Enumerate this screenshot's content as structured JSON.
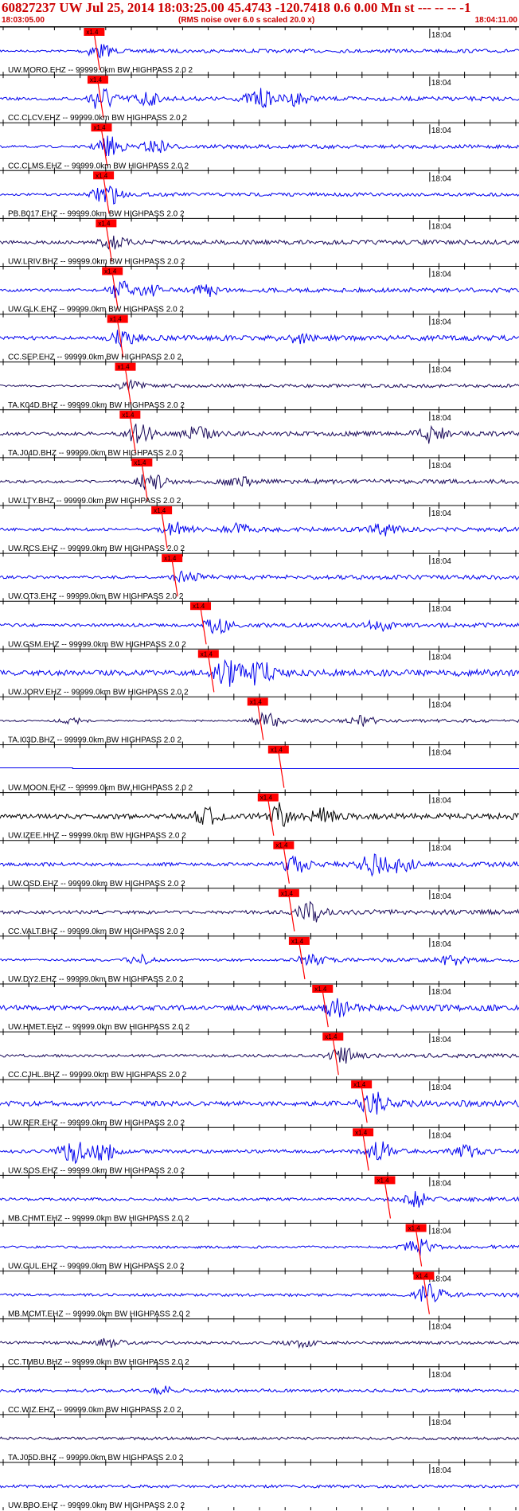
{
  "header": {
    "title": "60827237 UW Jul 25, 2014 18:03:25.00   45.4743 -120.7418  0.6 0.00 Mn st --- -- --  -1",
    "start_time": "18:03:05.00",
    "noise_note": "(RMS noise over 6.0 s scaled 20.0 x)",
    "end_time": "18:04:11.00"
  },
  "colors": {
    "trace_blue": "#0000ee",
    "trace_dark": "#1a0a5a",
    "trace_black": "#000000",
    "pick_red": "#ff0000",
    "title_red": "#cc0000"
  },
  "chart_data": {
    "type": "line",
    "title": "60827237 UW Jul 25, 2014 18:03:25.00",
    "x_start": "18:03:05.00",
    "x_end": "18:04:11.00",
    "time_mark": "18:04",
    "pick_label": "x1.4",
    "filter": "HIGHPASS  2.0  2",
    "stations": [
      {
        "label": "UW.MORO.EHZ -- 99999.0km BW  HIGHPASS  2.0  2",
        "color": "#0000ee",
        "pick": 18.0,
        "amp": 0.22,
        "bursts": [
          [
            19,
            1.5
          ]
        ]
      },
      {
        "label": "CC.CLCV.EHZ -- 99999.0km BW  HIGHPASS  2.0  2",
        "color": "#0000ee",
        "pick": 18.7,
        "amp": 0.3,
        "bursts": [
          [
            19.5,
            2.6
          ],
          [
            28,
            1.4
          ],
          [
            50,
            1.9
          ],
          [
            57,
            1.2
          ]
        ]
      },
      {
        "label": "CC.CLMS.EHZ -- 99999.0km BW  HIGHPASS  2.0  2",
        "color": "#0000ee",
        "pick": 19.4,
        "amp": 0.25,
        "bursts": [
          [
            21,
            2.0
          ],
          [
            30,
            1.2
          ]
        ]
      },
      {
        "label": "PB.B017.EHZ -- 99999.0km BW  HIGHPASS  2.0  2",
        "color": "#0000ee",
        "pick": 19.8,
        "amp": 0.22,
        "bursts": [
          [
            20.5,
            2.4
          ]
        ]
      },
      {
        "label": "UW.LRIV.BHZ -- 99999.0km BW  HIGHPASS  2.0  2",
        "color": "#1a0a5a",
        "pick": 20.3,
        "amp": 0.32,
        "bursts": [
          [
            21.5,
            1.3
          ]
        ]
      },
      {
        "label": "UW.GLK.EHZ -- 99999.0km BW  HIGHPASS  2.0  2",
        "color": "#0000ee",
        "pick": 21.5,
        "amp": 0.3,
        "bursts": [
          [
            23.5,
            1.7
          ],
          [
            29,
            0.9
          ],
          [
            40,
            1.0
          ]
        ]
      },
      {
        "label": "CC.SEP.EHZ -- 99999.0km BW  HIGHPASS  2.0  2",
        "color": "#0000ee",
        "pick": 22.5,
        "amp": 0.38,
        "bursts": [
          [
            24,
            1.6
          ],
          [
            57,
            1.0
          ]
        ]
      },
      {
        "label": "TA.K04D.BHZ -- 99999.0km BW  HIGHPASS  2.0  2",
        "color": "#1a0a5a",
        "pick": 24.0,
        "amp": 0.2,
        "bursts": [
          [
            25,
            0.9
          ]
        ]
      },
      {
        "label": "TA.J04D.BHZ -- 99999.0km BW  HIGHPASS  2.0  2",
        "color": "#1a0a5a",
        "pick": 24.9,
        "amp": 0.35,
        "bursts": [
          [
            27,
            1.8
          ],
          [
            38,
            1.3
          ],
          [
            83,
            1.9
          ]
        ]
      },
      {
        "label": "UW.LTY.BHZ -- 99999.0km BW  HIGHPASS  2.0  2",
        "color": "#1a0a5a",
        "pick": 27.2,
        "amp": 0.3,
        "bursts": [
          [
            29,
            1.6
          ],
          [
            46,
            0.9
          ]
        ]
      },
      {
        "label": "UW.RCS.EHZ -- 99999.0km BW  HIGHPASS  2.0  2",
        "color": "#0000ee",
        "pick": 31.0,
        "amp": 0.3,
        "bursts": [
          [
            34,
            1.4
          ],
          [
            46,
            1.1
          ],
          [
            74,
            1.0
          ]
        ]
      },
      {
        "label": "UW.OT3.EHZ -- 99999.0km BW  HIGHPASS  2.0  2",
        "color": "#0000ee",
        "pick": 33.0,
        "amp": 0.3,
        "bursts": [
          [
            36,
            1.0
          ]
        ]
      },
      {
        "label": "UW.GSM.EHZ -- 99999.0km BW  HIGHPASS  2.0  2",
        "color": "#0000ee",
        "pick": 38.5,
        "amp": 0.32,
        "bursts": [
          [
            42,
            1.5
          ],
          [
            73,
            1.0
          ]
        ]
      },
      {
        "label": "UW.JORV.EHZ -- 99999.0km BW  HIGHPASS  2.0  2",
        "color": "#0000ee",
        "pick": 40.0,
        "amp": 0.55,
        "bursts": [
          [
            44,
            2.8
          ],
          [
            50,
            2.2
          ]
        ]
      },
      {
        "label": "TA.I03D.BHZ -- 99999.0km BW  HIGHPASS  2.0  2",
        "color": "#1a0a5a",
        "pick": 49.5,
        "amp": 0.18,
        "bursts": [
          [
            51.5,
            1.8
          ],
          [
            14,
            0.6
          ],
          [
            70,
            0.9
          ]
        ]
      },
      {
        "label": "UW.MOON.EHZ -- 99999.0km BW  HIGHPASS  2.0  2",
        "color": "#0000ee",
        "pick": 53.5,
        "amp": 0.0,
        "bursts": []
      },
      {
        "label": "UW.IZEE.HHZ -- 99999.0km BW  HIGHPASS  2.0  2",
        "color": "#000000",
        "pick": 51.5,
        "amp": 0.5,
        "bursts": [
          [
            53.5,
            2.6
          ],
          [
            40,
            1.6
          ],
          [
            62,
            1.3
          ]
        ]
      },
      {
        "label": "UW.OSD.EHZ -- 99999.0km BW  HIGHPASS  2.0  2",
        "color": "#0000ee",
        "pick": 54.5,
        "amp": 0.35,
        "bursts": [
          [
            57,
            1.6
          ],
          [
            72,
            2.0
          ],
          [
            77,
            1.6
          ]
        ]
      },
      {
        "label": "CC.VALT.BHZ -- 99999.0km BW  HIGHPASS  2.0  2",
        "color": "#1a0a5a",
        "pick": 55.5,
        "amp": 0.35,
        "bursts": [
          [
            60,
            1.9
          ]
        ]
      },
      {
        "label": "UW.DY2.EHZ -- 99999.0km BW  HIGHPASS  2.0  2",
        "color": "#0000ee",
        "pick": 57.5,
        "amp": 0.25,
        "bursts": [
          [
            27,
            1.0
          ],
          [
            60,
            1.0
          ],
          [
            87,
            1.0
          ]
        ]
      },
      {
        "label": "UW.HMET.EHZ -- 99999.0km BW  HIGHPASS  2.0  2",
        "color": "#0000ee",
        "pick": 62.0,
        "amp": 0.5,
        "bursts": [
          [
            65,
            1.7
          ]
        ]
      },
      {
        "label": "CC.CJHL.BHZ -- 99999.0km BW  HIGHPASS  2.0  2",
        "color": "#1a0a5a",
        "pick": 64.0,
        "amp": 0.28,
        "bursts": [
          [
            66,
            1.5
          ]
        ]
      },
      {
        "label": "UW.RER.EHZ -- 99999.0km BW  HIGHPASS  2.0  2",
        "color": "#0000ee",
        "pick": 69.5,
        "amp": 0.5,
        "bursts": [
          [
            72,
            2.1
          ]
        ]
      },
      {
        "label": "UW.SOS.EHZ -- 99999.0km BW  HIGHPASS  2.0  2",
        "color": "#0000ee",
        "pick": 69.8,
        "amp": 0.35,
        "bursts": [
          [
            14,
            2.4
          ],
          [
            20,
            1.8
          ],
          [
            73,
            1.8
          ],
          [
            90,
            1.0
          ]
        ]
      },
      {
        "label": "MB.CHMT.EHZ -- 99999.0km BW  HIGHPASS  2.0  2",
        "color": "#0000ee",
        "pick": 74.0,
        "amp": 0.3,
        "bursts": [
          [
            80,
            1.4
          ]
        ]
      },
      {
        "label": "UW.GUL.EHZ -- 99999.0km BW  HIGHPASS  2.0  2",
        "color": "#0000ee",
        "pick": 80.0,
        "amp": 0.25,
        "bursts": [
          [
            80.5,
            1.6
          ]
        ]
      },
      {
        "label": "MB.MCMT.EHZ -- 99999.0km BW  HIGHPASS  2.0  2",
        "color": "#0000ee",
        "pick": 81.5,
        "amp": 0.28,
        "bursts": [
          [
            83,
            2.4
          ]
        ]
      },
      {
        "label": "CC.TMBU.BHZ -- 99999.0km BW  HIGHPASS  2.0  2",
        "color": "#1a0a5a",
        "pick": null,
        "amp": 0.3,
        "bursts": [
          [
            21,
            0.8
          ],
          [
            58,
            0.8
          ]
        ]
      },
      {
        "label": "CC.WIZ.EHZ -- 99999.0km BW  HIGHPASS  2.0  2",
        "color": "#0000ee",
        "pick": null,
        "amp": 0.32,
        "bursts": [
          [
            32,
            0.7
          ]
        ]
      },
      {
        "label": "TA.J05D.BHZ -- 99999.0km BW  HIGHPASS  2.0  2",
        "color": "#1a0a5a",
        "pick": null,
        "amp": 0.3,
        "bursts": []
      },
      {
        "label": "UW.BBO.EHZ -- 99999.0km BW  HIGHPASS  2.0  2",
        "color": "#0000ee",
        "pick": null,
        "amp": 0.3,
        "bursts": []
      }
    ]
  }
}
